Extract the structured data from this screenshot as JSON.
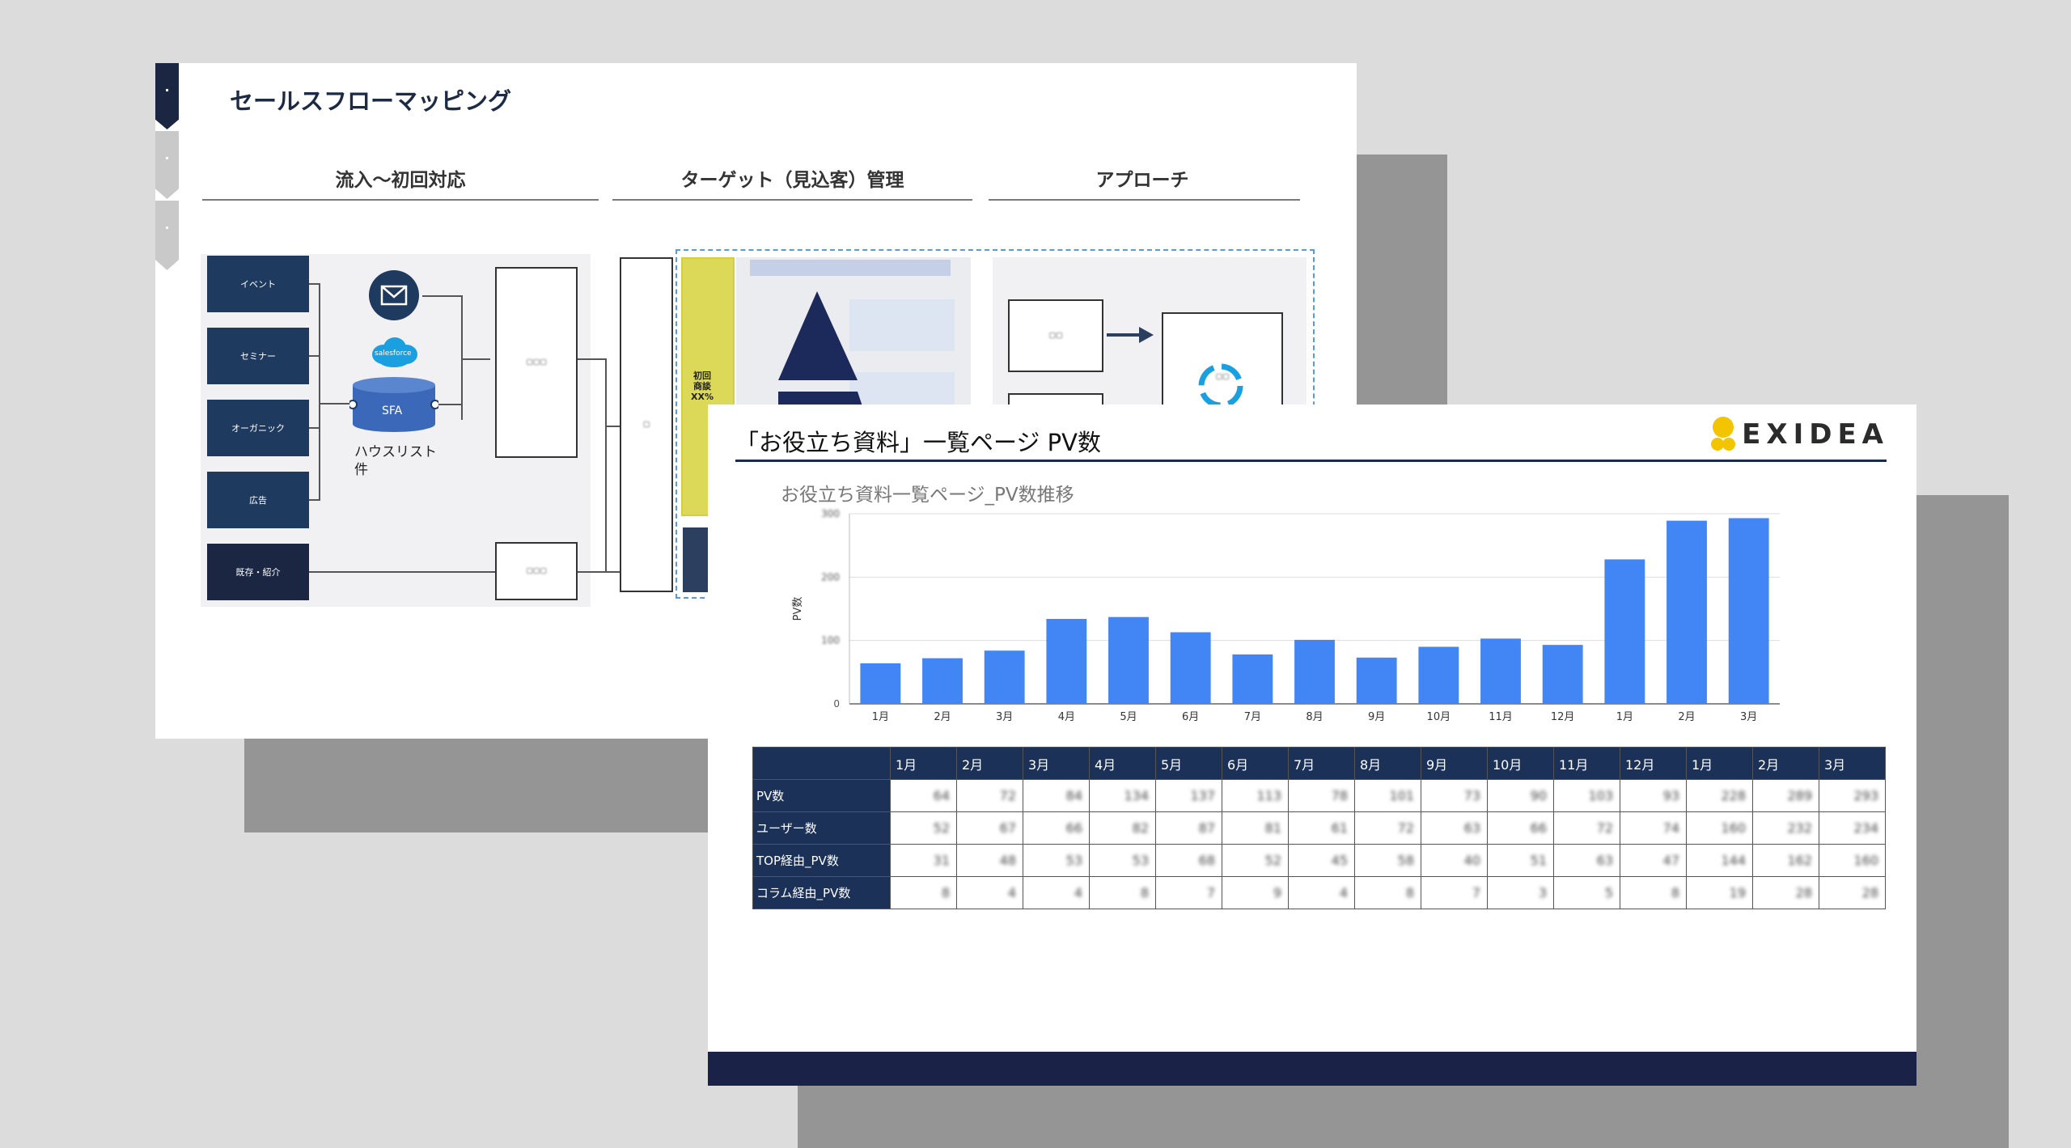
{
  "slide1": {
    "title": "セールスフローマッピング",
    "columns": [
      "流入～初回対応",
      "ターゲット（見込客）管理",
      "アプローチ"
    ],
    "sources": [
      "イベント",
      "セミナー",
      "オーガニック",
      "広告",
      "既存・紹介"
    ],
    "salesforce_label": "salesforce",
    "sfa_label": "SFA",
    "house_list": [
      "ハウスリスト",
      "件"
    ],
    "initial_rate": [
      "初回",
      "商談",
      "XX%"
    ]
  },
  "slide2": {
    "title": "「お役立ち資料」一覧ページ PV数",
    "logo_text": "EXIDEA",
    "chart_title": "お役立ち資料一覧ページ_PV数推移",
    "table": {
      "headers": [
        "1月",
        "2月",
        "3月",
        "4月",
        "5月",
        "6月",
        "7月",
        "8月",
        "9月",
        "10月",
        "11月",
        "12月",
        "1月",
        "2月",
        "3月"
      ],
      "rows": [
        {
          "label": "PV数",
          "values": [
            64,
            72,
            84,
            134,
            137,
            113,
            78,
            101,
            73,
            90,
            103,
            93,
            228,
            289,
            293
          ]
        },
        {
          "label": "ユーザー数",
          "values": [
            52,
            67,
            66,
            82,
            87,
            81,
            61,
            72,
            63,
            66,
            72,
            74,
            160,
            232,
            234
          ]
        },
        {
          "label": "TOP経由_PV数",
          "values": [
            31,
            48,
            53,
            53,
            68,
            52,
            45,
            58,
            40,
            51,
            63,
            47,
            144,
            162,
            160
          ]
        },
        {
          "label": "コラム経由_PV数",
          "values": [
            8,
            4,
            4,
            8,
            7,
            9,
            4,
            8,
            7,
            3,
            5,
            8,
            19,
            28,
            28
          ]
        }
      ]
    }
  },
  "chart_data": {
    "type": "bar",
    "title": "お役立ち資料一覧ページ_PV数推移",
    "xlabel": "",
    "ylabel": "PV数",
    "categories": [
      "1月",
      "2月",
      "3月",
      "4月",
      "5月",
      "6月",
      "7月",
      "8月",
      "9月",
      "10月",
      "11月",
      "12月",
      "1月",
      "2月",
      "3月"
    ],
    "values": [
      64,
      72,
      84,
      134,
      137,
      113,
      78,
      101,
      73,
      90,
      103,
      93,
      228,
      289,
      293
    ],
    "ylim": [
      0,
      300
    ],
    "yticks": [
      0,
      100,
      200,
      300
    ],
    "grid": true,
    "legend": "none",
    "color": "#4285f4"
  },
  "colors": {
    "navy": "#1b3158",
    "bar": "#4285f4",
    "footer": "#1b2248",
    "accent_yellow": "#f3c400"
  }
}
